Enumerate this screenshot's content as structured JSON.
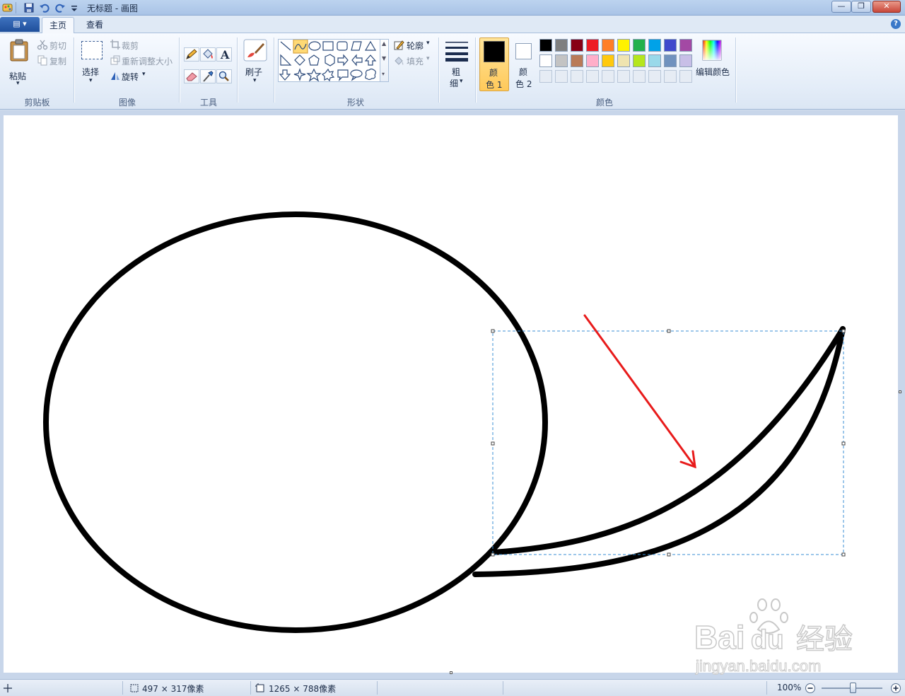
{
  "window": {
    "title": "无标题 - 画图",
    "min_glyph": "—",
    "max_glyph": "❐",
    "close_glyph": "✕"
  },
  "tabs": {
    "app_menu": "▤ ▾",
    "home": "主页",
    "view": "查看",
    "help_glyph": "?"
  },
  "clipboard": {
    "paste": "粘贴",
    "cut": "剪切",
    "copy": "复制",
    "group": "剪贴板"
  },
  "image": {
    "select": "选择",
    "crop": "裁剪",
    "resize": "重新调整大小",
    "rotate": "旋转",
    "group": "图像"
  },
  "tools": {
    "text_glyph": "A",
    "group": "工具"
  },
  "brush": {
    "label": "刷子"
  },
  "shapes": {
    "outline": "轮廓",
    "fill": "填充",
    "group": "形状"
  },
  "size": {
    "label_1": "粗",
    "label_2": "细"
  },
  "colors": {
    "color1_a": "颜",
    "color1_b": "色 1",
    "color2_a": "颜",
    "color2_b": "色 2",
    "edit": "编辑颜色",
    "group": "颜色",
    "palette_row1": [
      "#000000",
      "#7f7f7f",
      "#880015",
      "#ed1c24",
      "#ff7f27",
      "#fff200",
      "#22b14c",
      "#00a2e8",
      "#3f48cc",
      "#a349a4"
    ],
    "palette_row2": [
      "#ffffff",
      "#c3c3c3",
      "#b97a57",
      "#ffaec9",
      "#ffc90e",
      "#efe4b0",
      "#b5e61d",
      "#99d9ea",
      "#7092be",
      "#c8bfe7"
    ],
    "color1": "#000000",
    "color2": "#ffffff"
  },
  "status": {
    "selection_size": "497 × 317像素",
    "canvas_size": "1265 × 788像素",
    "zoom": "100%"
  },
  "watermark": {
    "brand": "Bai",
    "brand_mid": "du",
    "brand_cn": "经验",
    "url": "jingyan.baidu.com"
  }
}
